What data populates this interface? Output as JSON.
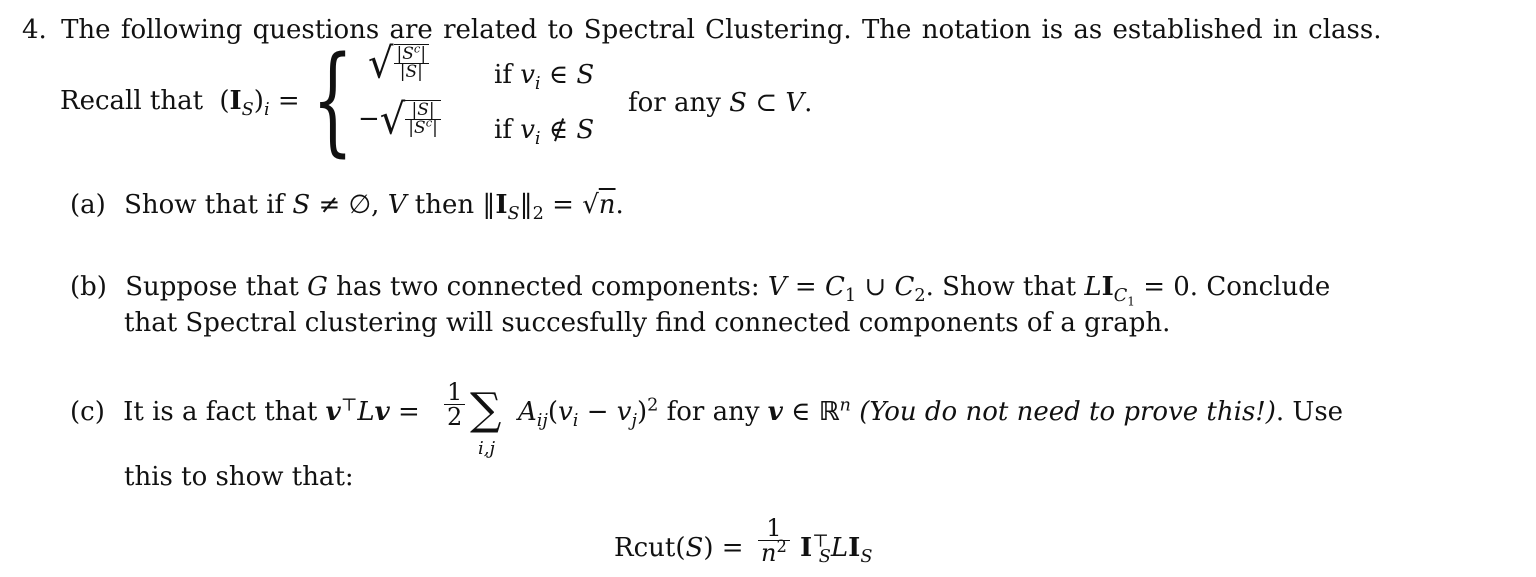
{
  "problem": {
    "number": "4.",
    "intro": "The following questions are related to Spectral Clustering.  The notation is as established in class.",
    "recall": {
      "lead": "Recall that",
      "lhs": "(I_S)_i =",
      "case1": {
        "value": "sqrt(|S^c| / |S|)",
        "cond": "if v_i ∈ S"
      },
      "case2": {
        "value": "-sqrt(|S| / |S^c|)",
        "cond": "if v_i ∉ S"
      },
      "tail": "for any S ⊂ V."
    }
  },
  "parts": [
    {
      "label": "(a)",
      "text": "Show that if S ≠ ∅, V then ‖I_S‖₂ = √n."
    },
    {
      "label": "(b)",
      "text": "Suppose that G has two connected components: V = C₁ ∪ C₂. Show that L I_{C₁} = 0. Conclude that Spectral clustering will succesfully find connected components of a graph."
    },
    {
      "label": "(c)",
      "text": "It is a fact that vᵀLv = ½ Σ_{i,j} A_ij (v_i − v_j)² for any v ∈ ℝⁿ (You do not need to prove this!). Use this to show that:",
      "display_equation": "Rcut(S) = (1/n²) I_Sᵀ L I_S"
    }
  ],
  "strings": {
    "num": "4.",
    "intro": "The following questions are related to Spectral Clustering.  The notation is as established in class.",
    "recall": "Recall that",
    "if": "if",
    "for_any": "for any",
    "a_label": "(a)",
    "a_show": "Show that if",
    "a_then": "then",
    "b_label": "(b)",
    "b_text1": "Suppose that",
    "b_text2": "has two connected components:",
    "b_text3": "Show that",
    "b_text4": "Conclude",
    "b_line2": "that Spectral clustering will succesfully find connected components of a graph.",
    "c_label": "(c)",
    "c_text1": "It is a fact that",
    "c_text2": "for any",
    "c_italic": "(You do not need to prove this!)",
    "c_use": ". Use",
    "c_line2": "this to show that:",
    "rcut": "Rcut"
  }
}
